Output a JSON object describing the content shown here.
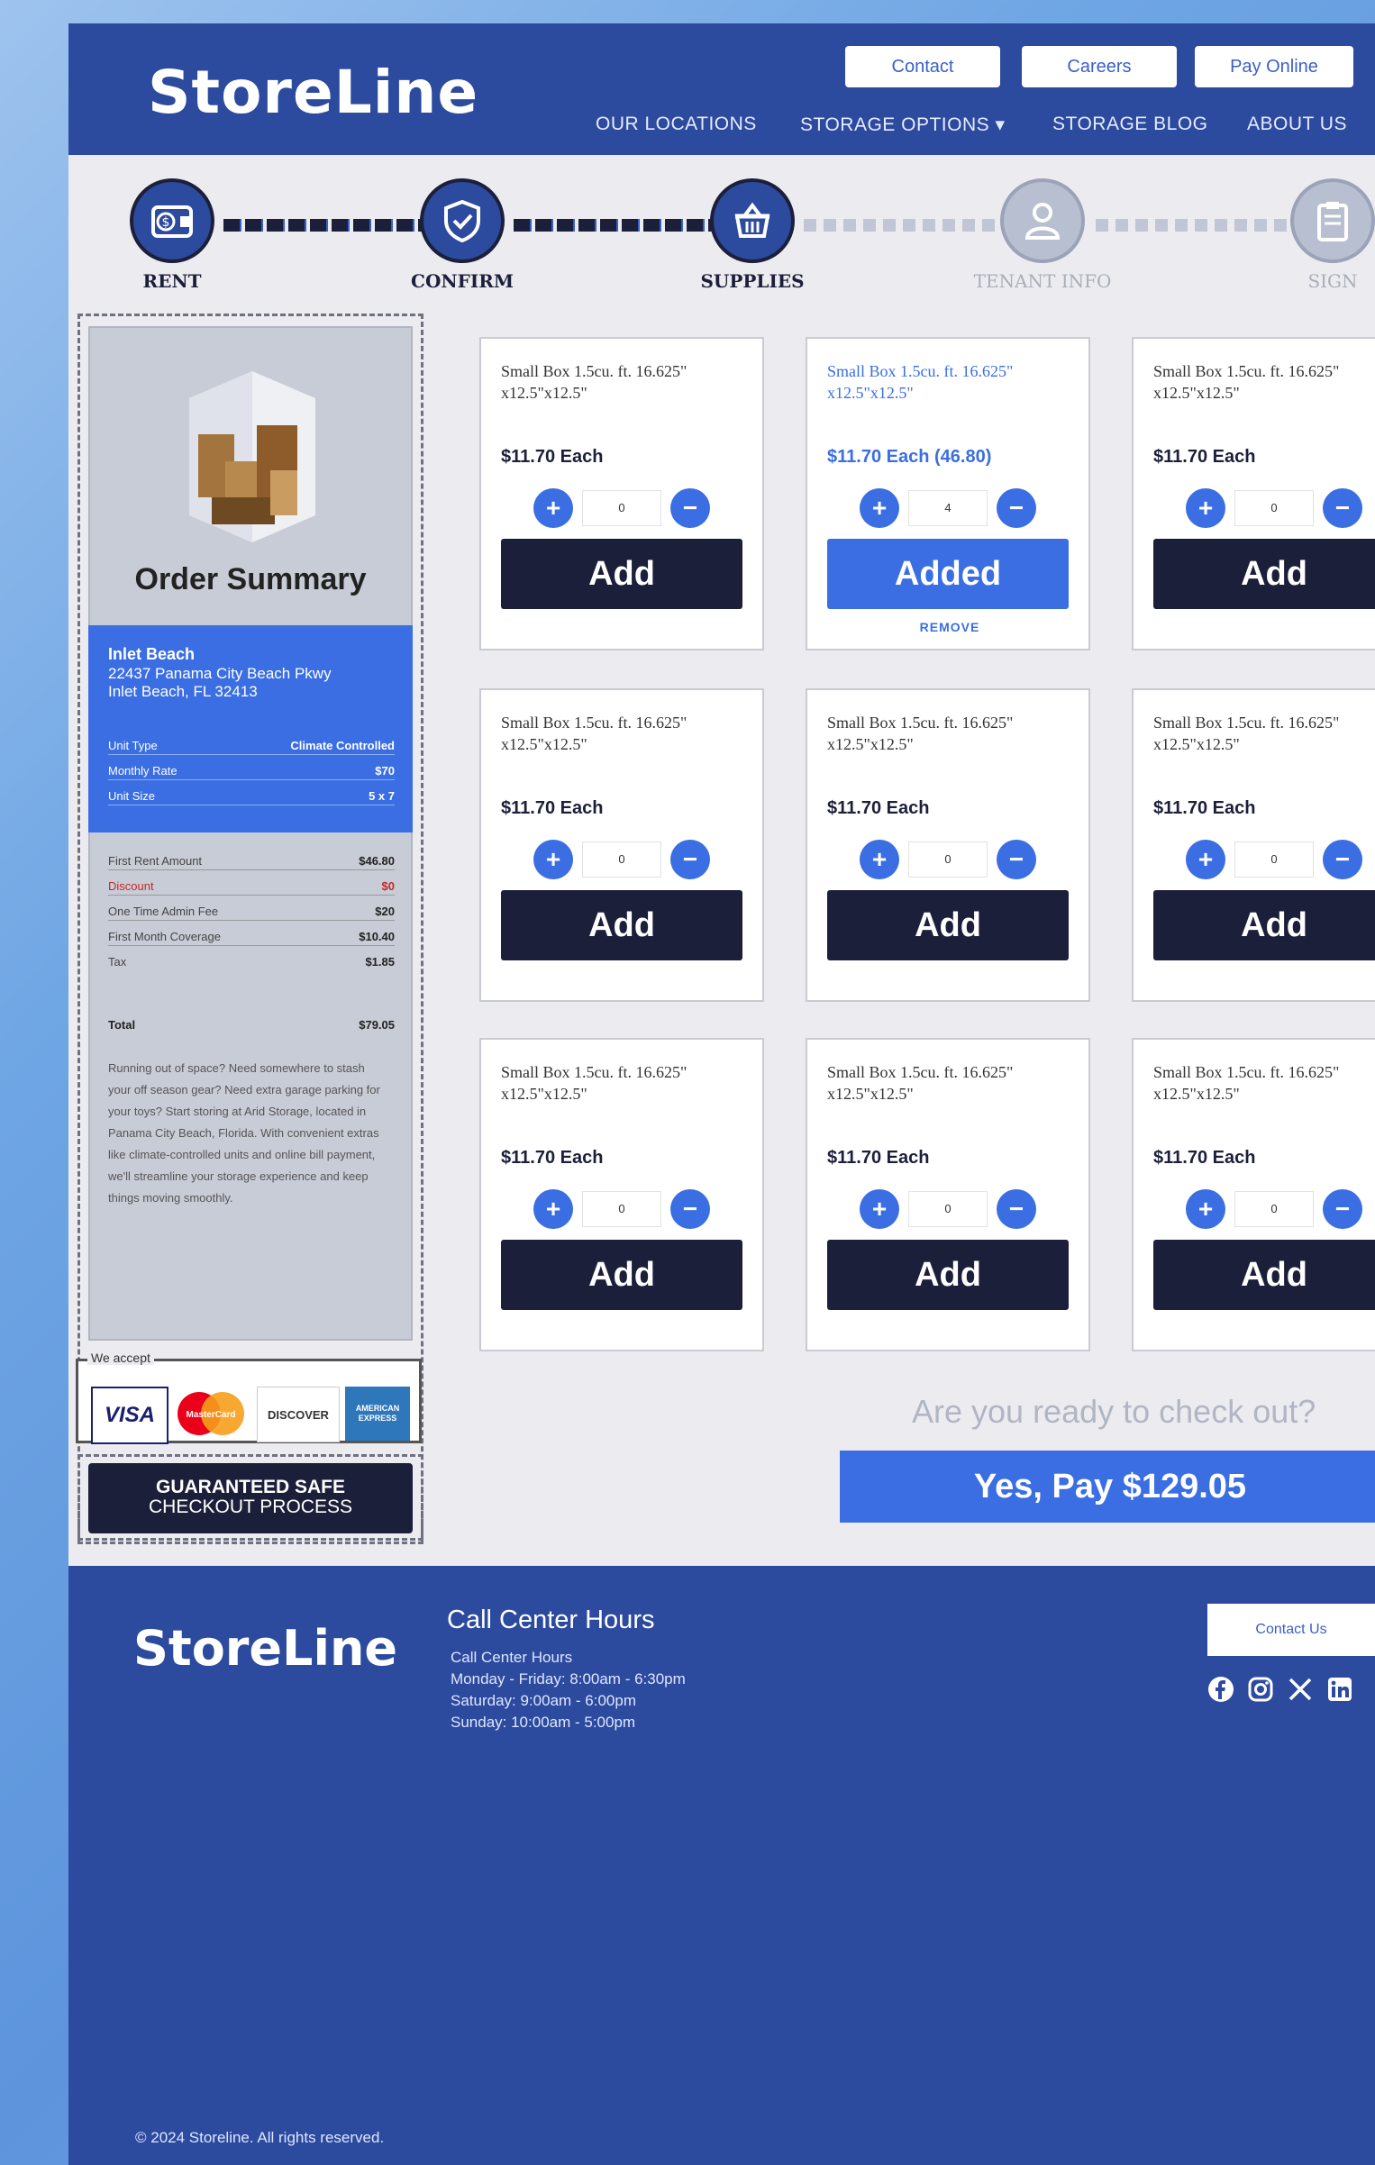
{
  "brand": "StoreLine",
  "topButtons": {
    "contact": "Contact",
    "careers": "Careers",
    "pay": "Pay Online"
  },
  "nav": {
    "locations": "OUR LOCATIONS",
    "options": "STORAGE OPTIONS ▾",
    "blog": "STORAGE BLOG",
    "about": "ABOUT US"
  },
  "steps": {
    "rent": "RENT",
    "confirm": "CONFIRM",
    "supplies": "SUPPLIES",
    "tenant": "TENANT INFO",
    "sign": "SIGN"
  },
  "summary": {
    "title": "Order Summary",
    "location_name": "Inlet Beach",
    "address": "22437 Panama City Beach Pkwy\nInlet Beach, FL 32413",
    "unit_rows": [
      {
        "label": "Unit Type",
        "value": "Climate Controlled"
      },
      {
        "label": "Monthly Rate",
        "value": "$70"
      },
      {
        "label": "Unit Size",
        "value": "5 x 7"
      }
    ],
    "fee_rows": [
      {
        "label": "First Rent Amount",
        "value": "$46.80"
      },
      {
        "label": "Discount",
        "value": "$0"
      },
      {
        "label": "One Time Admin Fee",
        "value": "$20"
      },
      {
        "label": "First Month Coverage",
        "value": "$10.40"
      },
      {
        "label": "Tax",
        "value": "$1.85"
      }
    ],
    "total_label": "Total",
    "total_value": "$79.05",
    "blurb": "Running out of space? Need somewhere to stash your off season gear? Need extra garage parking for your toys? Start storing at Arid Storage, located in Panama City Beach, Florida. With convenient extras like climate-controlled units and online bill payment, we'll streamline your storage experience and keep things moving smoothly."
  },
  "accept": {
    "label": "We accept",
    "visa": "VISA",
    "mastercard": "MasterCard",
    "discover": "DISCOVER",
    "amex": "AMERICAN EXPRESS"
  },
  "guarantee": {
    "line1": "GUARANTEED SAFE",
    "line2": "CHECKOUT PROCESS"
  },
  "products": [
    {
      "name": "Small Box 1.5cu. ft. 16.625\"\nx12.5\"x12.5\"",
      "price": "$11.70 Each",
      "qty": "0",
      "button": "Add",
      "remove": ""
    },
    {
      "name": "Small Box 1.5cu. ft. 16.625\"\nx12.5\"x12.5\"",
      "price": "$11.70 Each (46.80)",
      "qty": "4",
      "button": "Added",
      "remove": "REMOVE"
    },
    {
      "name": "Small Box 1.5cu. ft. 16.625\"\nx12.5\"x12.5\"",
      "price": "$11.70 Each",
      "qty": "0",
      "button": "Add",
      "remove": ""
    },
    {
      "name": "Small Box 1.5cu. ft. 16.625\"\nx12.5\"x12.5\"",
      "price": "$11.70 Each",
      "qty": "0",
      "button": "Add",
      "remove": ""
    },
    {
      "name": "Small Box 1.5cu. ft. 16.625\"\nx12.5\"x12.5\"",
      "price": "$11.70 Each",
      "qty": "0",
      "button": "Add",
      "remove": ""
    },
    {
      "name": "Small Box 1.5cu. ft. 16.625\"\nx12.5\"x12.5\"",
      "price": "$11.70 Each",
      "qty": "0",
      "button": "Add",
      "remove": ""
    },
    {
      "name": "Small Box 1.5cu. ft. 16.625\"\nx12.5\"x12.5\"",
      "price": "$11.70 Each",
      "qty": "0",
      "button": "Add",
      "remove": ""
    },
    {
      "name": "Small Box 1.5cu. ft. 16.625\"\nx12.5\"x12.5\"",
      "price": "$11.70 Each",
      "qty": "0",
      "button": "Add",
      "remove": ""
    },
    {
      "name": "Small Box 1.5cu. ft. 16.625\"\nx12.5\"x12.5\"",
      "price": "$11.70 Each",
      "qty": "0",
      "button": "Add",
      "remove": ""
    }
  ],
  "checkout": {
    "question": "Are you ready to check out?",
    "pay_label": "Yes, Pay $129.05"
  },
  "footer": {
    "heading": "Call Center Hours",
    "lines": [
      "Call Center Hours",
      "Monday - Friday: 8:00am - 6:30pm",
      "Saturday: 9:00am - 6:00pm",
      "Sunday: 10:00am - 5:00pm"
    ],
    "contact": "Contact Us",
    "copyright": "© 2024 Storeline. All rights reserved."
  },
  "icons": {
    "rent": "wallet-icon",
    "confirm": "shield-check-icon",
    "supplies": "basket-icon",
    "tenant": "user-icon",
    "sign": "clipboard-icon"
  },
  "colors": {
    "brand": "#2c4a9e",
    "accent": "#3a6ee2",
    "dark": "#1c1f3a"
  }
}
